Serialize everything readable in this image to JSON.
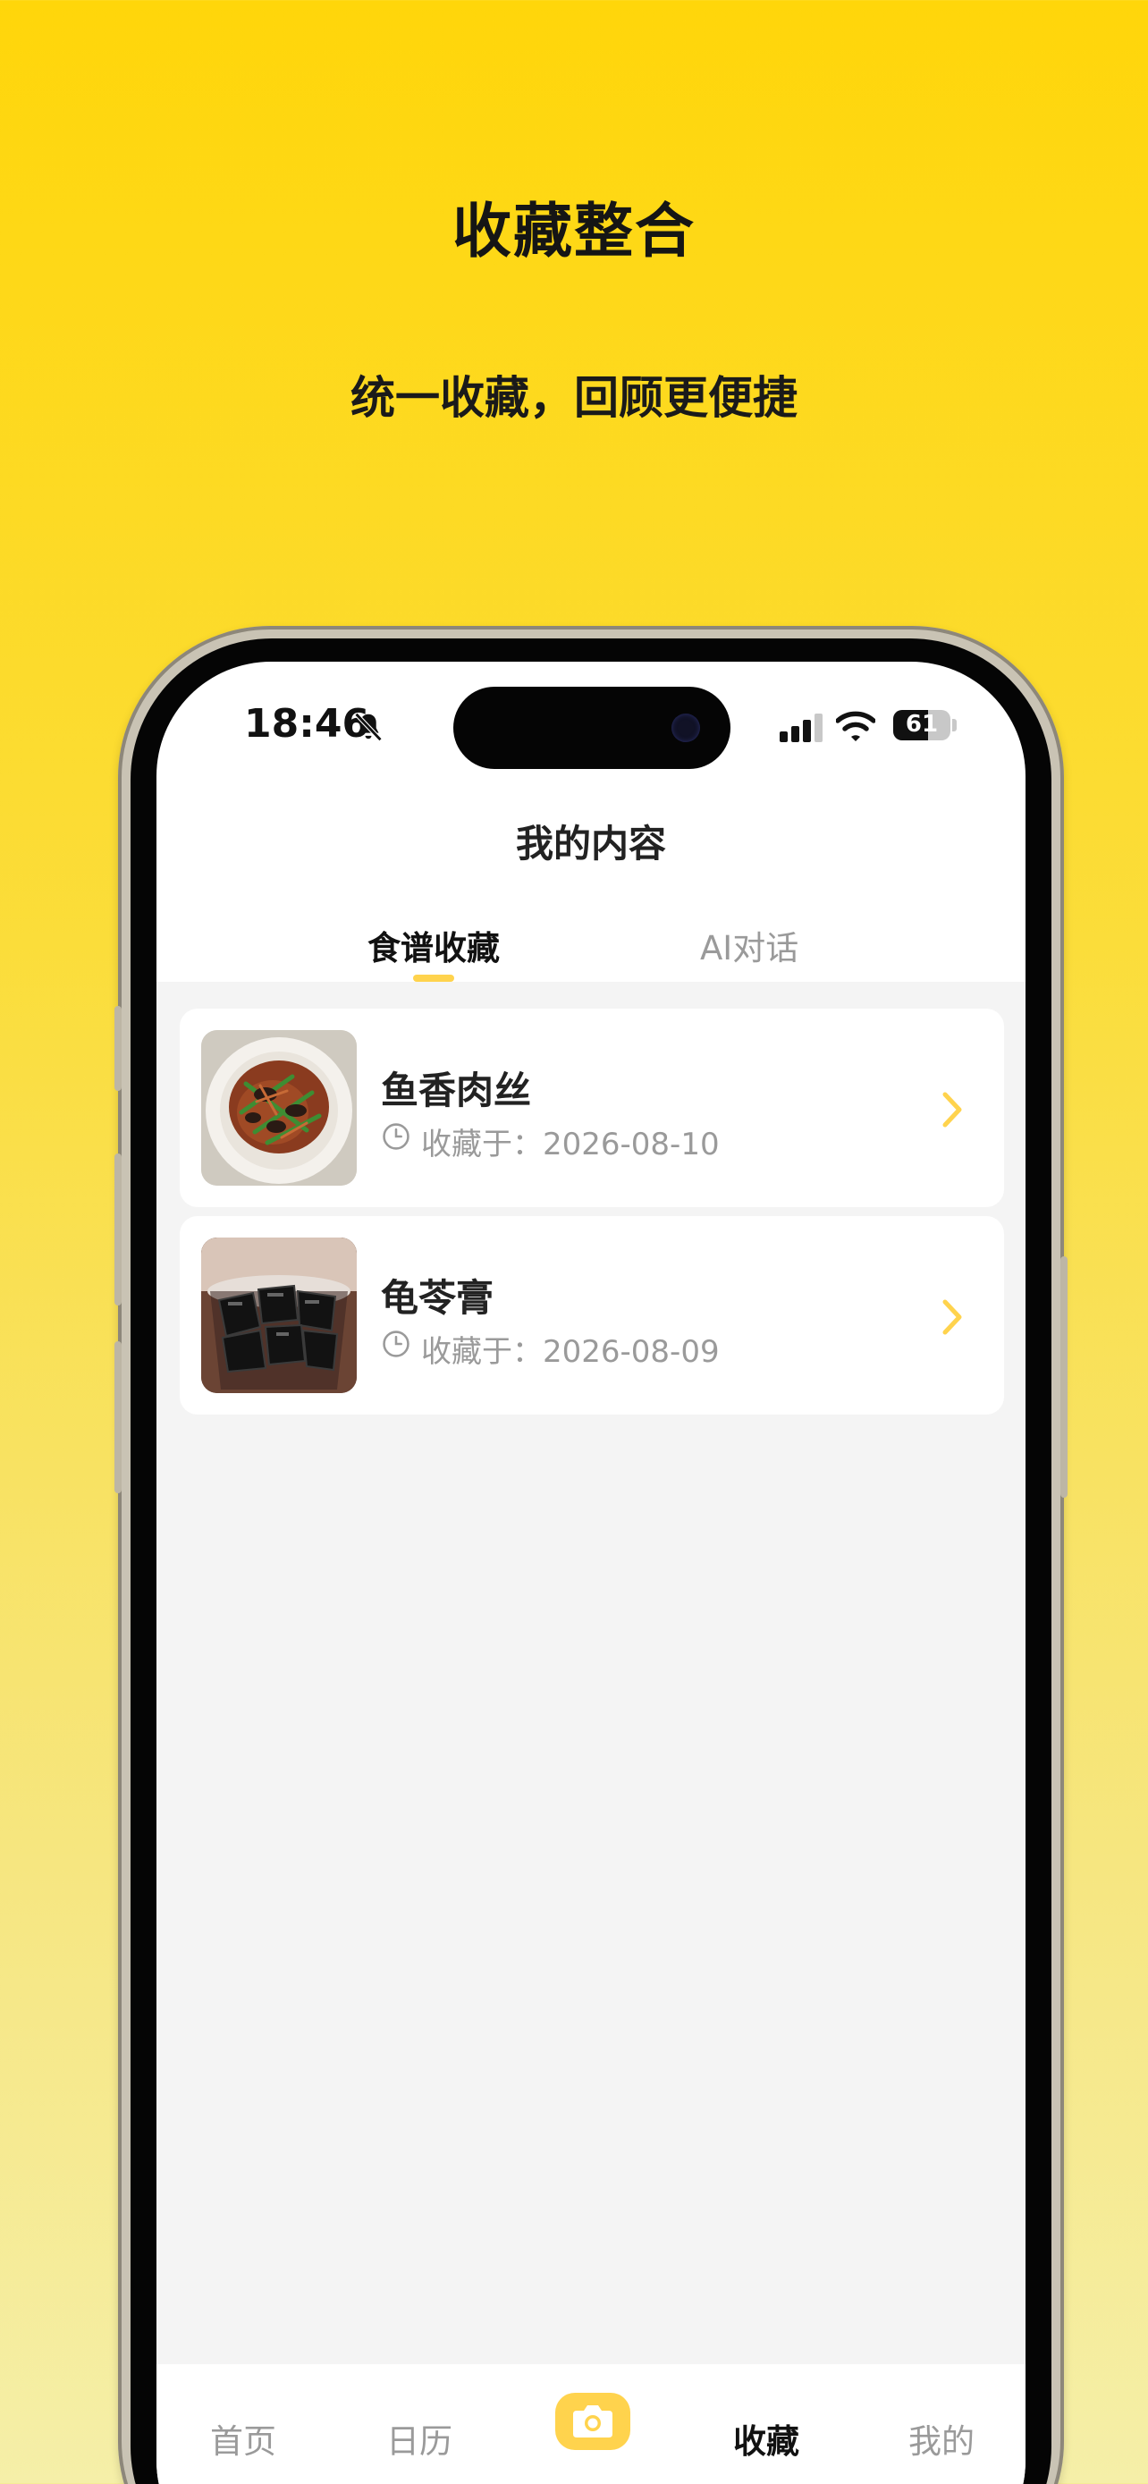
{
  "promo": {
    "title": "收藏整合",
    "subtitle": "统一收藏，回顾更便捷"
  },
  "status_bar": {
    "time": "18:46",
    "battery_level": "61",
    "battery_fraction": 0.61,
    "icons": [
      "bell-slash-icon",
      "signal-icon",
      "wifi-icon",
      "battery-icon"
    ]
  },
  "header": {
    "title": "我的内容"
  },
  "tabs": [
    {
      "label": "食谱收藏",
      "active": true
    },
    {
      "label": "AI对话",
      "active": false
    }
  ],
  "favorites": [
    {
      "name": "鱼香肉丝",
      "date": "收藏于：2026-08-10",
      "image": "dish-yuxiang-rousi-photo"
    },
    {
      "name": "龟苓膏",
      "date": "收藏于：2026-08-09",
      "image": "dish-guilinggao-photo"
    }
  ],
  "bottom_nav": [
    {
      "label": "首页",
      "active": false
    },
    {
      "label": "日历",
      "active": false
    },
    {
      "label": "",
      "icon": "camera-icon",
      "active": false
    },
    {
      "label": "收藏",
      "active": true
    },
    {
      "label": "我的",
      "active": false
    }
  ],
  "colors": {
    "accent": "#FFD34D",
    "background_top": "#FFD60A",
    "background_bottom": "#F5EFA8",
    "text_primary": "#222222",
    "text_secondary": "#9A9A9A"
  }
}
